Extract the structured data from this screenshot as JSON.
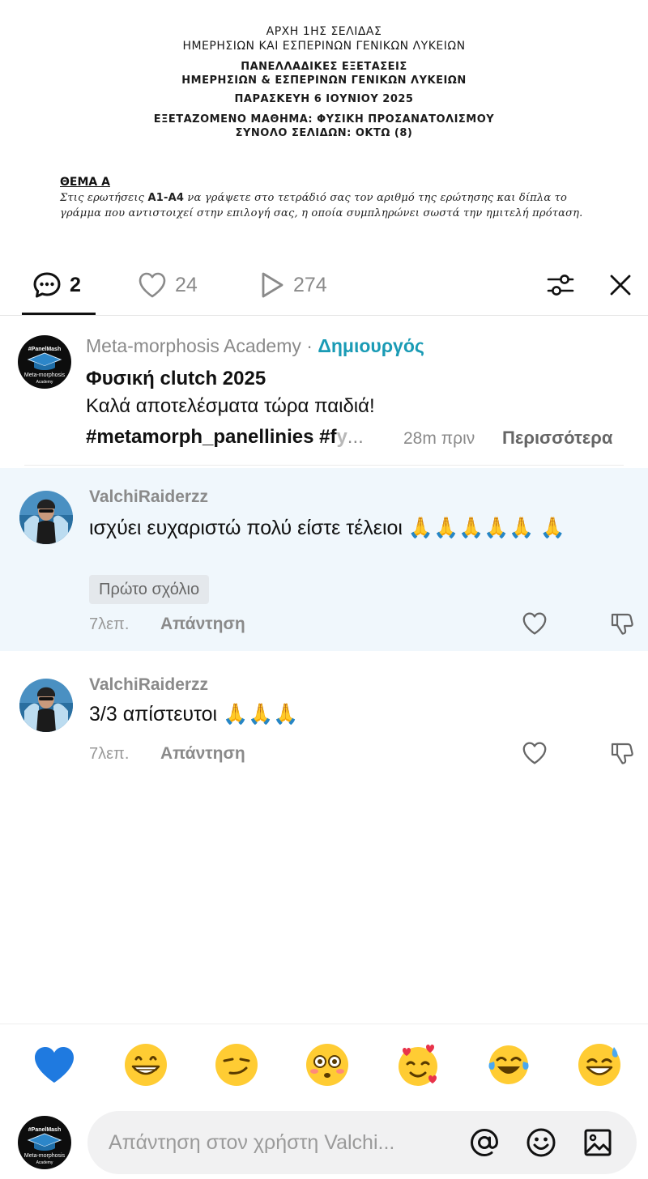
{
  "document": {
    "header_lines": [
      "ΑΡΧΗ 1ΗΣ ΣΕΛΙΔΑΣ",
      "ΗΜΕΡΗΣΙΩΝ ΚΑΙ ΕΣΠΕΡΙΝΩΝ ΓΕΝΙΚΩΝ ΛΥΚΕΙΩΝ"
    ],
    "exam_lines": [
      "ΠΑΝΕΛΛΑΔΙΚΕΣ ΕΞΕΤΑΣΕΙΣ",
      "ΗΜΕΡΗΣΙΩΝ & ΕΣΠΕΡΙΝΩΝ ΓΕΝΙΚΩΝ ΛΥΚΕΙΩΝ"
    ],
    "date_line": "ΠΑΡΑΣΚΕΥΗ 6 ΙΟΥΝΙΟΥ 2025",
    "subject_line": "ΕΞΕΤΑΖΟΜΕΝΟ ΜΑΘΗΜΑ: ΦΥΣΙΚΗ  ΠΡΟΣΑΝΑΤΟΛΙΣΜΟΥ",
    "pages_line": "ΣΥΝΟΛΟ ΣΕΛΙΔΩΝ: ΟΚΤΩ (8)",
    "theme": "ΘΕΜΑ Α",
    "para_before": "Στις ερωτήσεις ",
    "para_bold": "Α1-Α4",
    "para_after": " να γράψετε στο τετράδιό σας τον αριθμό της ερώτησης και δίπλα το γράμμα που αντιστοιχεί στην επιλογή σας, η οποία συμπληρώνει σωστά την ημιτελή πρόταση."
  },
  "stats": {
    "comments": "2",
    "likes": "24",
    "views": "274"
  },
  "caption": {
    "author": "Meta-morphosis Academy",
    "dot": " · ",
    "creator_label": "Δημιουργός",
    "title": "Φυσική clutch 2025",
    "text": "Καλά αποτελέσματα τώρα παιδιά!",
    "hashtags": "#metamorph_panellinies #f",
    "hashtags_faded": "y",
    "ellipsis": "...",
    "time": "28m πριν",
    "more": "Περισσότερα",
    "avatar_line1": "#PanelMash",
    "avatar_line2": "Meta-morphosis",
    "avatar_line3": "Academy"
  },
  "comments": [
    {
      "user": "ValchiRaiderzz",
      "text": "ισχύει ευχαριστώ πολύ είστε τέλειοι 🙏🙏🙏🙏🙏 🙏",
      "badge": "Πρώτο σχόλιο",
      "time": "7λεπ.",
      "reply": "Απάντηση"
    },
    {
      "user": "ValchiRaiderzz",
      "text": "3/3 απίστευτοι 🙏🙏🙏",
      "time": "7λεπ.",
      "reply": "Απάντηση"
    }
  ],
  "emoji_bar": [
    "blue-heart",
    "grinning-face",
    "smirking-face",
    "flushed-face",
    "smiling-face-with-hearts",
    "tears-of-joy-face",
    "sweat-smile-face"
  ],
  "composer": {
    "placeholder": "Απάντηση στον χρήστη Valchi..."
  },
  "colors": {
    "accent": "#1a9bb5",
    "highlight_bg": "#f0f7fc",
    "muted_text": "#8a8a8a"
  }
}
